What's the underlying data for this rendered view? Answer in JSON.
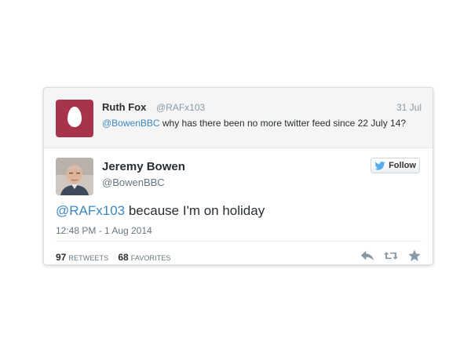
{
  "parent_tweet": {
    "name": "Ruth Fox",
    "handle": "@RAFx103",
    "date": "31 Jul",
    "mention": "@BowenBBC",
    "text": " why has there been no more twitter feed since 22 July 14?",
    "avatar_icon": "egg-icon",
    "avatar_color": "#a8344b"
  },
  "main_tweet": {
    "name": "Jeremy Bowen",
    "handle": "@BowenBBC",
    "follow_label": "Follow",
    "mention": "@RAFx103",
    "text": " because I'm on holiday",
    "timestamp": "12:48 PM - 1 Aug 2014",
    "retweets_count": "97",
    "retweets_label": "RETWEETS",
    "favorites_count": "68",
    "favorites_label": "FAVORITES"
  },
  "colors": {
    "link": "#3b88c3",
    "twitter_blue": "#55acee",
    "muted": "#8899a6",
    "action_icon": "#8899a6"
  },
  "icons": {
    "follow": "twitter-bird-icon",
    "reply": "reply-icon",
    "retweet": "retweet-icon",
    "favorite": "star-icon"
  }
}
